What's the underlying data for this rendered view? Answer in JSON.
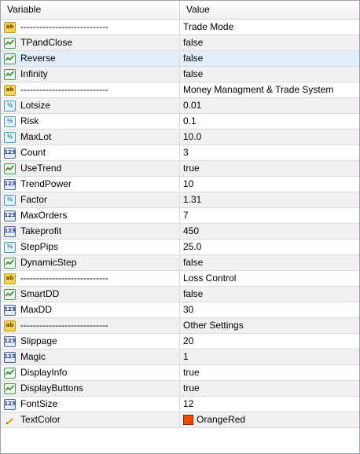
{
  "header": {
    "col_variable": "Variable",
    "col_value": "Value"
  },
  "rows": [
    {
      "name": "----------------------------",
      "value": "Trade Mode",
      "type": "ab"
    },
    {
      "name": "TPandClose",
      "value": "false",
      "type": "bool"
    },
    {
      "name": "Reverse",
      "value": "false",
      "type": "bool"
    },
    {
      "name": "Infinity",
      "value": "false",
      "type": "bool"
    },
    {
      "name": "----------------------------",
      "value": "Money Managment & Trade System",
      "type": "ab"
    },
    {
      "name": "Lotsize",
      "value": "0.01",
      "type": "dbl"
    },
    {
      "name": "Risk",
      "value": "0.1",
      "type": "dbl"
    },
    {
      "name": "MaxLot",
      "value": "10.0",
      "type": "dbl"
    },
    {
      "name": "Count",
      "value": "3",
      "type": "int"
    },
    {
      "name": "UseTrend",
      "value": "true",
      "type": "bool"
    },
    {
      "name": "TrendPower",
      "value": "10",
      "type": "int"
    },
    {
      "name": "Factor",
      "value": "1.31",
      "type": "dbl"
    },
    {
      "name": "MaxOrders",
      "value": "7",
      "type": "int"
    },
    {
      "name": "Takeprofit",
      "value": "450",
      "type": "int"
    },
    {
      "name": "StepPips",
      "value": "25.0",
      "type": "dbl"
    },
    {
      "name": "DynamicStep",
      "value": "false",
      "type": "bool"
    },
    {
      "name": "----------------------------",
      "value": "Loss Control",
      "type": "ab"
    },
    {
      "name": "SmartDD",
      "value": "false",
      "type": "bool"
    },
    {
      "name": "MaxDD",
      "value": "30",
      "type": "int"
    },
    {
      "name": "----------------------------",
      "value": "Other Settings",
      "type": "ab"
    },
    {
      "name": "Slippage",
      "value": "20",
      "type": "int"
    },
    {
      "name": "Magic",
      "value": "1",
      "type": "int"
    },
    {
      "name": "DisplayInfo",
      "value": "true",
      "type": "bool"
    },
    {
      "name": "DisplayButtons",
      "value": "true",
      "type": "bool"
    },
    {
      "name": "FontSize",
      "value": "12",
      "type": "int"
    },
    {
      "name": "TextColor",
      "value": "OrangeRed",
      "type": "color",
      "color": "#ff4500"
    }
  ],
  "selected_row": "Reverse",
  "icons": {
    "ab": "ab",
    "dbl": "½",
    "int": "123"
  }
}
